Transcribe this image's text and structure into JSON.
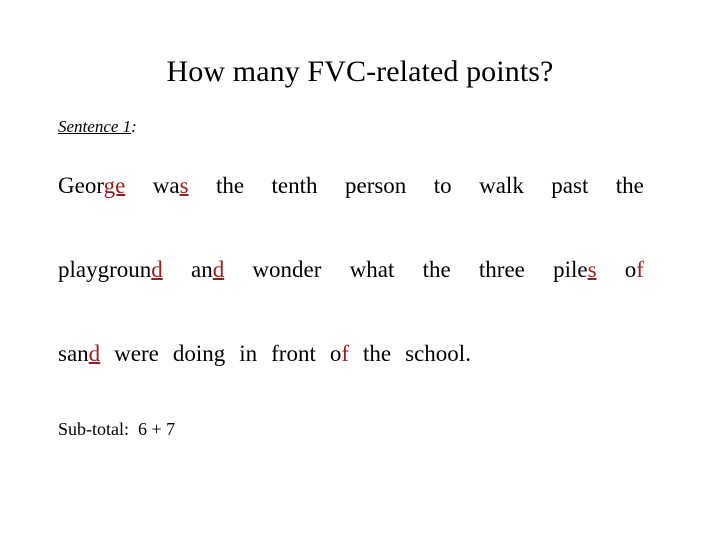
{
  "slide": {
    "background_color": "#ffffff",
    "title": "How many FVC-related points?",
    "mark_color": "#9E1B1B",
    "text_color": "#000000"
  },
  "sentence_label": {
    "underlined_text": "Sentence 1",
    "colon": ":"
  },
  "sentence": {
    "full_text": "George was the tenth person to walk past the playground and wonder what the three piles of sand were doing in front of the school.",
    "lines": [
      {
        "id": "line-1",
        "justified": true,
        "tokens": [
          {
            "plain": "Geor",
            "marked": "ge",
            "marked_underline": true,
            "tail": ""
          },
          {
            "plain": "wa",
            "marked": "s",
            "marked_underline": true,
            "tail": ""
          },
          {
            "plain": "the",
            "marked": "",
            "marked_underline": false,
            "tail": ""
          },
          {
            "plain": "tenth",
            "marked": "",
            "marked_underline": false,
            "tail": ""
          },
          {
            "plain": "person",
            "marked": "",
            "marked_underline": false,
            "tail": ""
          },
          {
            "plain": "to",
            "marked": "",
            "marked_underline": false,
            "tail": ""
          },
          {
            "plain": "walk",
            "marked": "",
            "marked_underline": false,
            "tail": ""
          },
          {
            "plain": "past",
            "marked": "",
            "marked_underline": false,
            "tail": ""
          },
          {
            "plain": "the",
            "marked": "",
            "marked_underline": false,
            "tail": ""
          }
        ]
      },
      {
        "id": "line-2",
        "justified": true,
        "tokens": [
          {
            "plain": "playgroun",
            "marked": "d",
            "marked_underline": true,
            "tail": ""
          },
          {
            "plain": "an",
            "marked": "d",
            "marked_underline": true,
            "tail": ""
          },
          {
            "plain": "wonder",
            "marked": "",
            "marked_underline": false,
            "tail": ""
          },
          {
            "plain": "what",
            "marked": "",
            "marked_underline": false,
            "tail": ""
          },
          {
            "plain": "the",
            "marked": "",
            "marked_underline": false,
            "tail": ""
          },
          {
            "plain": "three",
            "marked": "",
            "marked_underline": false,
            "tail": ""
          },
          {
            "plain": "pile",
            "marked": "s",
            "marked_underline": true,
            "tail": ""
          },
          {
            "plain": "o",
            "marked": "f",
            "marked_underline": false,
            "tail": ""
          }
        ]
      },
      {
        "id": "line-3",
        "justified": false,
        "tokens": [
          {
            "plain": "san",
            "marked": "d",
            "marked_underline": true,
            "tail": ""
          },
          {
            "plain": "were",
            "marked": "",
            "marked_underline": false,
            "tail": ""
          },
          {
            "plain": "doing",
            "marked": "",
            "marked_underline": false,
            "tail": ""
          },
          {
            "plain": "in",
            "marked": "",
            "marked_underline": false,
            "tail": ""
          },
          {
            "plain": "front",
            "marked": "",
            "marked_underline": false,
            "tail": ""
          },
          {
            "plain": "o",
            "marked": "f",
            "marked_underline": false,
            "tail": ""
          },
          {
            "plain": "the",
            "marked": "",
            "marked_underline": false,
            "tail": ""
          },
          {
            "plain": "school.",
            "marked": "",
            "marked_underline": false,
            "tail": ""
          }
        ]
      }
    ]
  },
  "subtotal": {
    "label": "Sub-total:",
    "value": "6 + 7",
    "text": "Sub-total:  6 + 7"
  }
}
